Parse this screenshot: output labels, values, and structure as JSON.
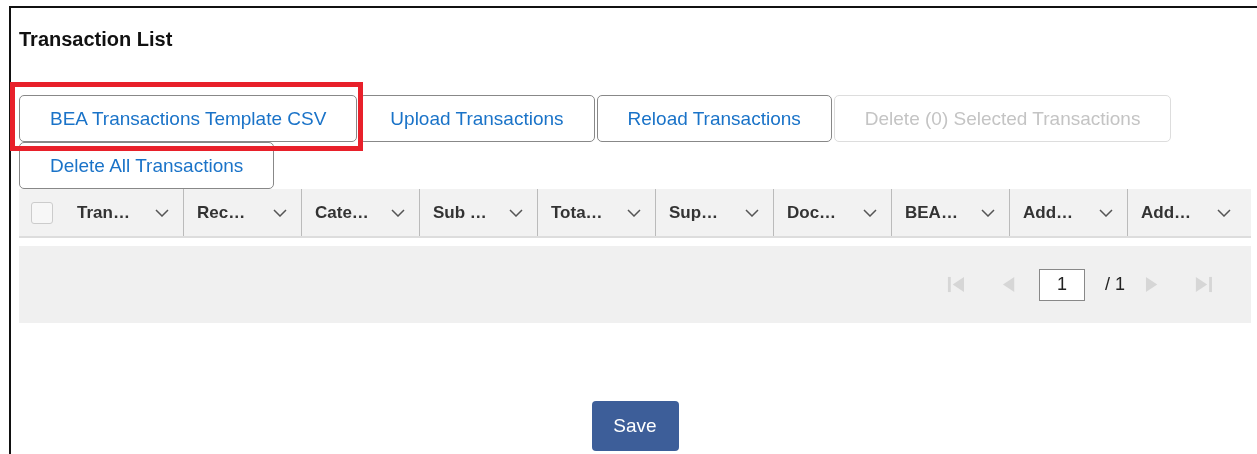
{
  "panel": {
    "title": "Transaction List"
  },
  "buttons": [
    {
      "label": "BEA Transactions Template CSV",
      "disabled": false,
      "highlighted": true
    },
    {
      "label": "Upload Transactions",
      "disabled": false,
      "highlighted": false
    },
    {
      "label": "Reload Transactions",
      "disabled": false,
      "highlighted": false
    },
    {
      "label": "Delete (0) Selected Transactions",
      "disabled": true,
      "highlighted": false
    },
    {
      "label": "Delete All Transactions",
      "disabled": false,
      "highlighted": false
    }
  ],
  "table": {
    "select_all": {
      "checked": false
    },
    "columns": [
      "Tran…",
      "Rec…",
      "Cate…",
      "Sub …",
      "Tota…",
      "Sup…",
      "Doc…",
      "BEA…",
      "Add…",
      "Add…"
    ]
  },
  "pager": {
    "page": "1",
    "total": "/ 1",
    "first_disabled": true,
    "prev_disabled": true,
    "next_disabled": true,
    "last_disabled": true
  },
  "save_button": "Save"
}
